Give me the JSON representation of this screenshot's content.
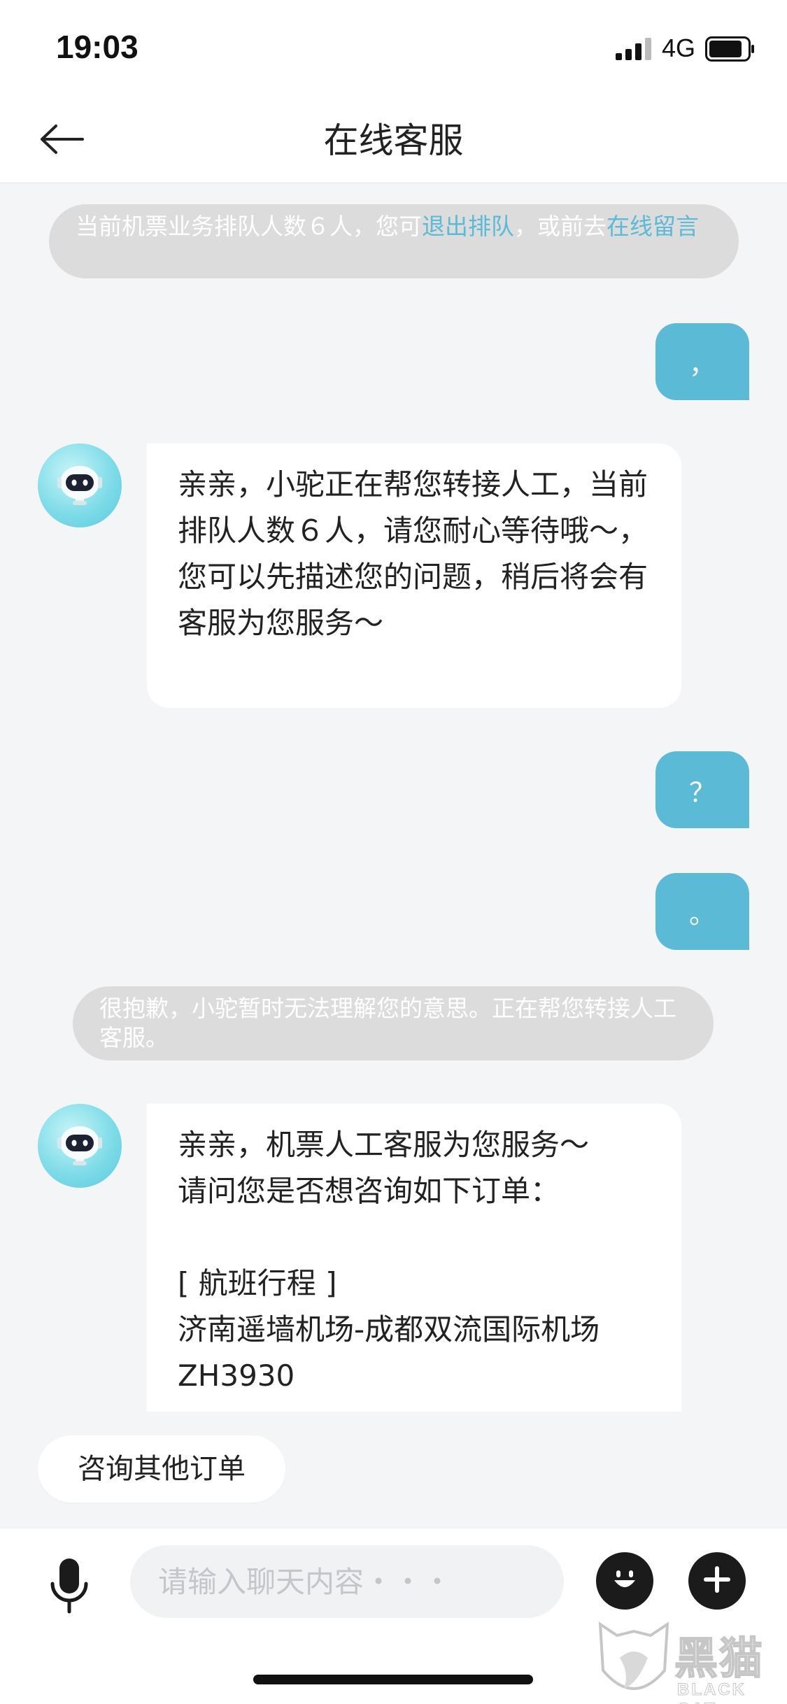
{
  "status_bar": {
    "time": "19:03",
    "network": "4G",
    "icons": [
      "signal-icon",
      "battery-icon"
    ]
  },
  "nav": {
    "title": "在线客服",
    "back_icon": "arrow-left-icon"
  },
  "messages": [
    {
      "type": "system",
      "segments": [
        {
          "text": "当前机票业务排队人数６人，您可"
        },
        {
          "text": "退出排队",
          "link": true
        },
        {
          "text": "，或前去"
        },
        {
          "text": "在线留言",
          "link": true
        }
      ]
    },
    {
      "type": "user",
      "text": "，"
    },
    {
      "type": "agent",
      "text": "亲亲，小驼正在帮您转接人工，当前排队人数６人，请您耐心等待哦～，您可以先描述您的问题，稍后将会有客服为您服务～"
    },
    {
      "type": "user",
      "text": "？"
    },
    {
      "type": "user",
      "text": "。"
    },
    {
      "type": "system",
      "text": "很抱歉，小驼暂时无法理解您的意思。正在帮您转接人工客服。"
    },
    {
      "type": "agent",
      "text": "亲亲，机票人工客服为您服务～\n请问您是否想咨询如下订单：\n\n[ 航班行程 ]\n济南遥墙机场-成都双流国际机场\nZH3930"
    }
  ],
  "quick_reply": {
    "label": "咨询其他订单"
  },
  "input_bar": {
    "placeholder": "请输入聊天内容・・・",
    "value": "",
    "icons": [
      "microphone-icon",
      "emoji-icon",
      "plus-icon"
    ]
  },
  "watermark": {
    "cn": "黑猫",
    "en": "BLACK CAT"
  },
  "colors": {
    "accent": "#5bbad6",
    "background": "#f4f5f7",
    "system_notice": "#dcdcdc",
    "bubble_agent": "#ffffff"
  }
}
